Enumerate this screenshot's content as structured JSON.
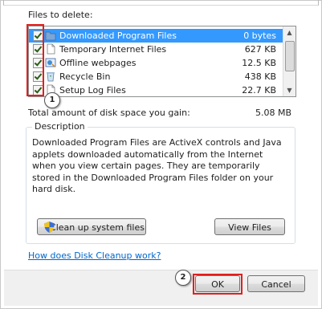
{
  "files_label": "Files to delete:",
  "files": [
    {
      "name": "Downloaded Program Files",
      "size": "0 bytes",
      "checked": true,
      "selected": true,
      "icon": "folder-icon"
    },
    {
      "name": "Temporary Internet Files",
      "size": "627 KB",
      "checked": true,
      "selected": false,
      "icon": "document-icon"
    },
    {
      "name": "Offline webpages",
      "size": "12.5 KB",
      "checked": true,
      "selected": false,
      "icon": "offline-webpages-icon"
    },
    {
      "name": "Recycle Bin",
      "size": "438 KB",
      "checked": true,
      "selected": false,
      "icon": "recycle-bin-icon"
    },
    {
      "name": "Setup Log Files",
      "size": "22.7 KB",
      "checked": true,
      "selected": false,
      "icon": "document-icon"
    }
  ],
  "total_label": "Total amount of disk space you gain:",
  "total_value": "5.08 MB",
  "description_title": "Description",
  "description_text": "Downloaded Program Files are ActiveX controls and Java applets downloaded automatically from the Internet when you view certain pages. They are temporarily stored in the Downloaded Program Files folder on your hard disk.",
  "cleanup_button": "Clean up system files",
  "view_files_button": "View Files",
  "help_link": "How does Disk Cleanup work?",
  "ok_button": "OK",
  "cancel_button": "Cancel",
  "annotations": [
    "1",
    "2"
  ],
  "colors": {
    "selection": "#3399ff",
    "annotation_red": "#e02020",
    "link": "#0066cc"
  }
}
